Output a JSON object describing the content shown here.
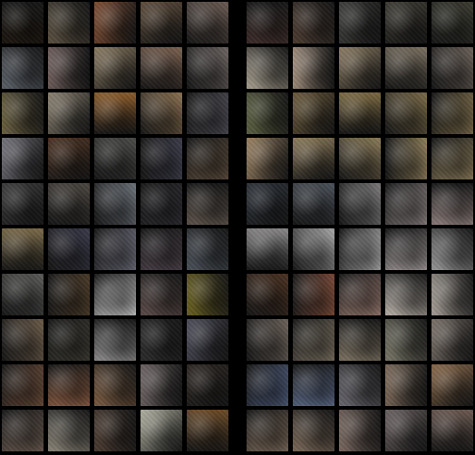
{
  "panels": [
    {
      "id": "left",
      "rows": [
        [
          "#1a140e",
          "#5a5040",
          "#7a4a30",
          "#5c4a38",
          "#6a5a52"
        ],
        [
          "#5a6068",
          "#6a5a58",
          "#8a7a60",
          "#7a6050",
          "#6a6260"
        ],
        [
          "#6a6040",
          "#8a8070",
          "#8a5a28",
          "#8a7050",
          "#4a4850"
        ],
        [
          "#707078",
          "#4a3020",
          "#4a4a48",
          "#3a3a48",
          "#5a4a3a"
        ],
        [
          "#383838",
          "#4a4540",
          "#6a7078",
          "#2a2a30",
          "#5a5048"
        ],
        [
          "#7a6a48",
          "#383848",
          "#6a6a78",
          "#4a4048",
          "#4a5058"
        ],
        [
          "#5a5a58",
          "#4a3a28",
          "#c8c8c8",
          "#5a4a48",
          "#6a6020"
        ],
        [
          "#6a5a48",
          "#3a3830",
          "#8a8888",
          "#2a2a2a",
          "#4a4a58"
        ],
        [
          "#6a4a38",
          "#8a5a40",
          "#7a5a40",
          "#6a6060",
          "#2a2420"
        ],
        [
          "#6a5a50",
          "#8a8478",
          "#4a3a30",
          "#b0b0a0",
          "#6a4a28"
        ]
      ]
    },
    {
      "id": "right",
      "rows": [
        [
          "#3a2a28",
          "#4a3a30",
          "#3a3a38",
          "#3a3830",
          "#3a3a30"
        ],
        [
          "#a8a090",
          "#9a8878",
          "#8a7a60",
          "#7a7060",
          "#6a6058"
        ],
        [
          "#5a6040",
          "#6a5838",
          "#7a6840",
          "#7a6a48",
          "#7a6a48"
        ],
        [
          "#9a8060",
          "#8a7858",
          "#8a7a58",
          "#8a7a58",
          "#8a7a58"
        ],
        [
          "#2a3038",
          "#4a5058",
          "#7a7878",
          "#8a8080",
          "#8a7a78"
        ],
        [
          "#8a8888",
          "#a8a8a8",
          "#a8a8a8",
          "#a09898",
          "#989898"
        ],
        [
          "#4a3020",
          "#7a4a38",
          "#9a7a70",
          "#b8b0a8",
          "#a8a098"
        ],
        [
          "#6a6058",
          "#7a7060",
          "#7a7060",
          "#7a7868",
          "#7a7068"
        ],
        [
          "#4a5878",
          "#5a6888",
          "#6a6870",
          "#7a6858",
          "#8a6848"
        ],
        [
          "#7a6858",
          "#7a6858",
          "#7a6860",
          "#6a6060",
          "#6a5850"
        ]
      ]
    }
  ]
}
